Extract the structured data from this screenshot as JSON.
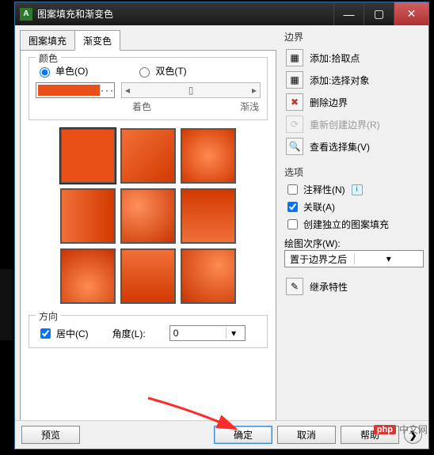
{
  "window": {
    "title": "图案填充和渐变色"
  },
  "tabs": {
    "pattern": "图案填充",
    "gradient": "渐变色"
  },
  "color": {
    "legend": "颜色",
    "single": "单色(O)",
    "double": "双色(T)",
    "tint": "着色",
    "light": "渐浅"
  },
  "direction": {
    "legend": "方向",
    "center": "居中(C)",
    "angle": "角度(L):",
    "angle_value": "0"
  },
  "boundary": {
    "label": "边界",
    "add_pick": "添加:拾取点",
    "add_select": "添加:选择对象",
    "delete": "删除边界",
    "recreate": "重新创建边界(R)",
    "viewsel": "查看选择集(V)"
  },
  "options": {
    "label": "选项",
    "annotative": "注释性(N)",
    "assoc": "关联(A)",
    "independent": "创建独立的图案填充",
    "draworder": "绘图次序(W):",
    "draworder_value": "置于边界之后"
  },
  "inherit": "继承特性",
  "footer": {
    "preview": "预览",
    "ok": "确定",
    "cancel": "取消",
    "help": "帮助"
  },
  "watermark": {
    "brand": "php",
    "text": "中文网"
  },
  "icons": {
    "addpick": "▦",
    "addsel": "▦",
    "del": "✖",
    "recreate": "⟳",
    "view": "🔍",
    "inherit": "✎"
  }
}
